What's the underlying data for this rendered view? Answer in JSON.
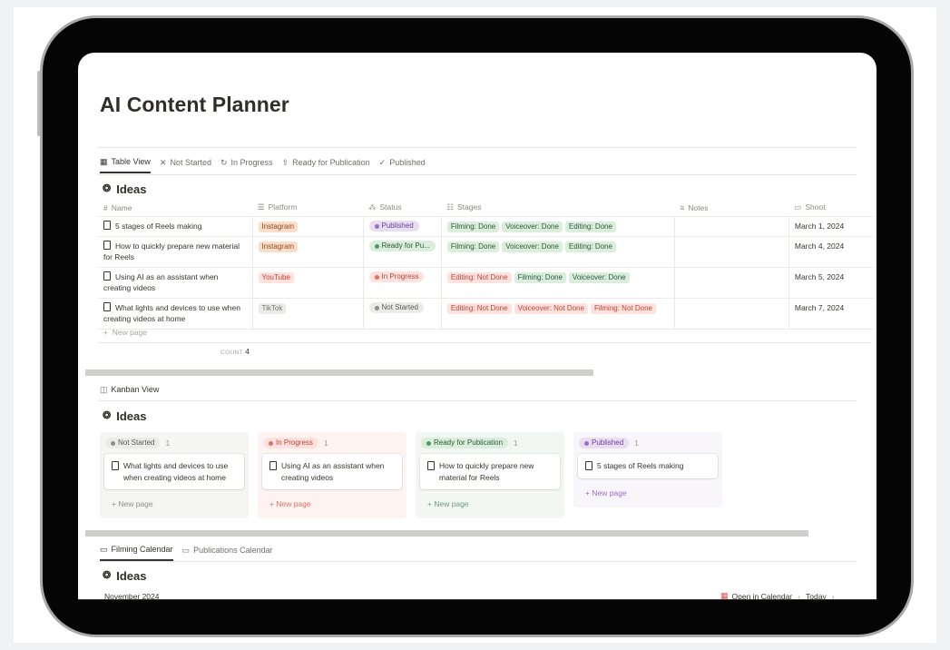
{
  "page": {
    "title": "AI Content Planner"
  },
  "views": [
    {
      "icon": "table-icon",
      "label": "Table View",
      "glyph": "▦",
      "active": true
    },
    {
      "icon": "x-icon",
      "label": "Not Started",
      "glyph": "✕",
      "active": false
    },
    {
      "icon": "refresh-icon",
      "label": "In Progress",
      "glyph": "↻",
      "active": false
    },
    {
      "icon": "upload-cloud-icon",
      "label": "Ready for Publication",
      "glyph": "⇪",
      "active": false
    },
    {
      "icon": "check-icon",
      "label": "Published",
      "glyph": "✓",
      "active": false
    }
  ],
  "table_section": {
    "db_title": "Ideas",
    "columns": [
      "Name",
      "Platform",
      "Status",
      "Stages",
      "Notes",
      "Shoot"
    ],
    "rows": [
      {
        "name": "5 stages of Reels making",
        "platform": "Instagram",
        "status": "Published",
        "stages": [
          "Filming: Done",
          "Voiceover: Done",
          "Editing: Done"
        ],
        "notes": "",
        "shoot": "March 1, 2024"
      },
      {
        "name": "How to quickly prepare new material for Reels",
        "platform": "Instagram",
        "status": "Ready for Pu...",
        "stages": [
          "Filming: Done",
          "Voiceover: Done",
          "Editing: Done"
        ],
        "notes": "",
        "shoot": "March 4, 2024"
      },
      {
        "name": "Using AI as an assistant when creating videos",
        "platform": "YouTube",
        "status": "In Progress",
        "stages": [
          "Editing: Not Done",
          "Filming: Done",
          "Voiceover: Done"
        ],
        "notes": "",
        "shoot": "March 5, 2024"
      },
      {
        "name": "What lights and devices to use when creating videos at home",
        "platform": "TikTok",
        "status": "Not Started",
        "stages": [
          "Editing: Not Done",
          "Voiceover: Not Done",
          "Filming: Not Done"
        ],
        "notes": "",
        "shoot": "March 7, 2024"
      }
    ],
    "new_page": "New page",
    "count_label": "COUNT",
    "count_value": "4"
  },
  "kanban_section": {
    "view_label": "Kanban View",
    "db_title": "Ideas",
    "new_page": "New page",
    "columns": [
      {
        "label": "Not Started",
        "count": "1",
        "card": "What lights and devices to use when creating videos at home"
      },
      {
        "label": "In Progress",
        "count": "1",
        "card": "Using AI as an assistant when creating videos"
      },
      {
        "label": "Ready for Publication",
        "count": "1",
        "card": "How to quickly prepare new material for Reels"
      },
      {
        "label": "Published",
        "count": "1",
        "card": "5 stages of Reels making"
      }
    ]
  },
  "calendar_section": {
    "tabs": [
      "Filming Calendar",
      "Publications Calendar"
    ],
    "db_title": "Ideas",
    "month": "November 2024",
    "open_in_calendar": "Open in Calendar",
    "today": "Today"
  },
  "colors": {
    "Instagram": [
      "#fadec9",
      "#8d4a23"
    ],
    "YouTube": [
      "#ffe2dd",
      "#c8403a"
    ],
    "TikTok": [
      "#ebebea",
      "#787774"
    ],
    "status_Published": [
      "#e8deee",
      "#6940a5",
      "#9a6dd7"
    ],
    "status_Ready": [
      "#dbeddb",
      "#2b593f",
      "#4f9768"
    ],
    "status_InProgress": [
      "#ffe2dd",
      "#b8433b",
      "#e16f64"
    ],
    "status_NotStarted": [
      "#ebebea",
      "#5a5955",
      "#8f8e8a"
    ],
    "stage_done": [
      "#dbeddb",
      "#2b593f"
    ],
    "stage_notdone": [
      "#ffe2dd",
      "#b8433b"
    ]
  }
}
